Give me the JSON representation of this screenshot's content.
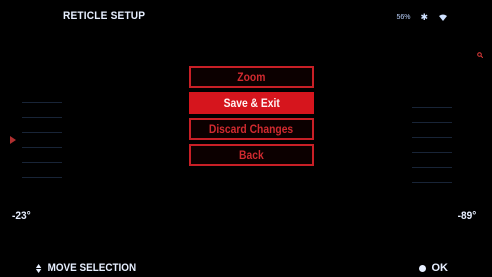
{
  "header": {
    "title": "RETICLE SETUP",
    "battery_text": "56%",
    "icons": [
      "bluetooth-icon",
      "wifi-icon"
    ]
  },
  "right_indicator": {
    "icon": "zoom-indicator-icon"
  },
  "angles": {
    "left": "-23°",
    "right": "-89°"
  },
  "menu": {
    "items": [
      {
        "label": "Zoom",
        "selected": false
      },
      {
        "label": "Save & Exit",
        "selected": true
      },
      {
        "label": "Discard Changes",
        "selected": false
      },
      {
        "label": "Back",
        "selected": false
      }
    ]
  },
  "footer": {
    "left_label": "MOVE SELECTION",
    "right_label": "OK"
  },
  "colors": {
    "accent_red": "#d6151d",
    "text": "#e7efff",
    "background": "#000000"
  }
}
